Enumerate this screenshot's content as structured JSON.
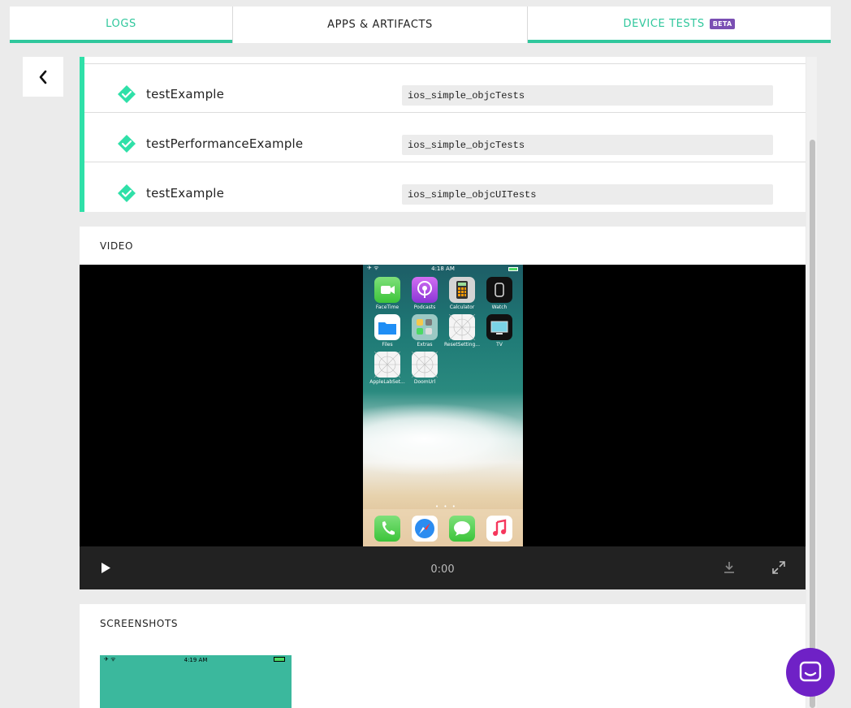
{
  "tabs": [
    {
      "label": "LOGS",
      "active": false
    },
    {
      "label": "APPS & ARTIFACTS",
      "active": true
    },
    {
      "label": "DEVICE TESTS",
      "badge": "BETA",
      "active": false
    }
  ],
  "colors": {
    "accent": "#2fc79c",
    "beta": "#7a4fb3",
    "chat": "#6f21c6"
  },
  "tests": [
    {
      "status": "passed",
      "name": "testExample",
      "suite": "ios_simple_objcTests"
    },
    {
      "status": "passed",
      "name": "testPerformanceExample",
      "suite": "ios_simple_objcTests"
    },
    {
      "status": "passed",
      "name": "testExample",
      "suite": "ios_simple_objcUITests"
    }
  ],
  "video": {
    "title": "VIDEO",
    "time": "0:00",
    "phone": {
      "status_time": "4:18 AM",
      "apps": [
        "FaceTime",
        "Podcasts",
        "Calculator",
        "Watch",
        "Files",
        "Extras",
        "ResetSetting...",
        "TV",
        "AppleLabSet...",
        "DoomUrl"
      ],
      "dock": [
        "Phone",
        "Safari",
        "Messages",
        "Music"
      ]
    }
  },
  "screenshots": {
    "title": "SCREENSHOTS",
    "first_status_time": "4:19 AM"
  }
}
